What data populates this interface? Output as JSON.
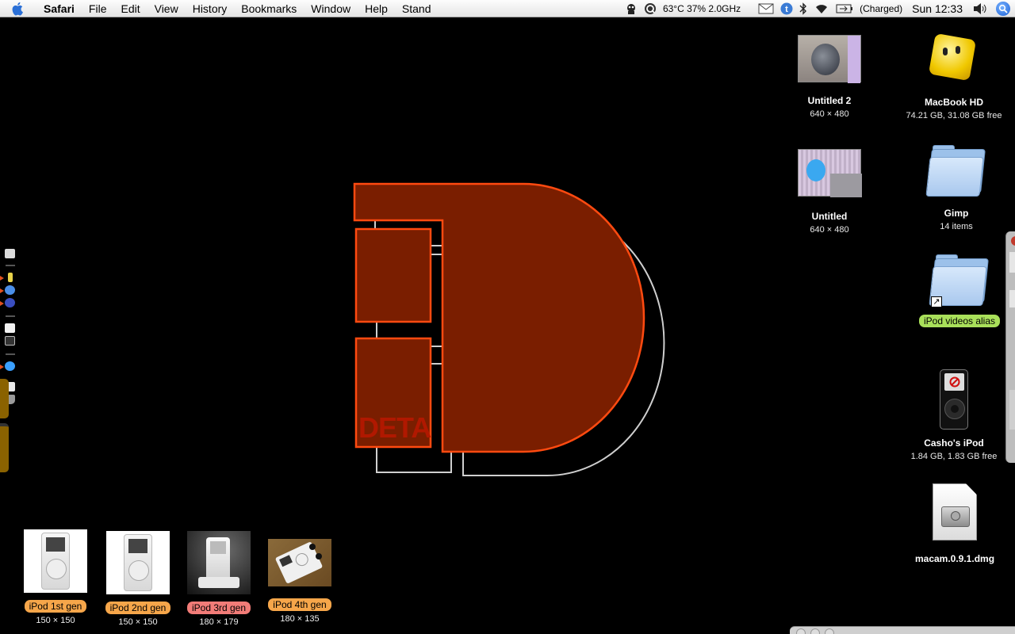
{
  "menubar": {
    "app": "Safari",
    "items": [
      "File",
      "Edit",
      "View",
      "History",
      "Bookmarks",
      "Window",
      "Help",
      "Stand"
    ],
    "status": {
      "cpu_text": "63°C 37% 2.0GHz",
      "battery_text": "(Charged)",
      "clock": "Sun 12:33"
    }
  },
  "desktop": {
    "icons": [
      {
        "name": "Untitled 2",
        "sub": "640 × 480"
      },
      {
        "name": "MacBook HD",
        "sub": "74.21 GB, 31.08 GB free"
      },
      {
        "name": "Untitled",
        "sub": "640 × 480"
      },
      {
        "name": "Gimp",
        "sub": "14 items"
      },
      {
        "name": "iPod videos alias",
        "sub": ""
      },
      {
        "name": "Casho's iPod",
        "sub": "1.84 GB, 1.83 GB free"
      },
      {
        "name": "macam.0.9.1.dmg",
        "sub": ""
      }
    ],
    "logo_text": "DETA",
    "ipods": [
      {
        "name": "iPod 1st gen",
        "dim": "150 × 150",
        "label_color": "#f6a64a"
      },
      {
        "name": "iPod 2nd gen",
        "dim": "150 × 150",
        "label_color": "#f6a64a"
      },
      {
        "name": "iPod 3rd gen",
        "dim": "180 × 179",
        "label_color": "#f27c78"
      },
      {
        "name": "iPod 4th gen",
        "dim": "180 × 135",
        "label_color": "#f6a64a"
      }
    ],
    "alias_label_color": "#a9e05a"
  },
  "colors": {
    "logo_fill": "#7a1e00",
    "logo_stroke": "#ff4a10",
    "logo_outline": "#cfcfcf"
  }
}
